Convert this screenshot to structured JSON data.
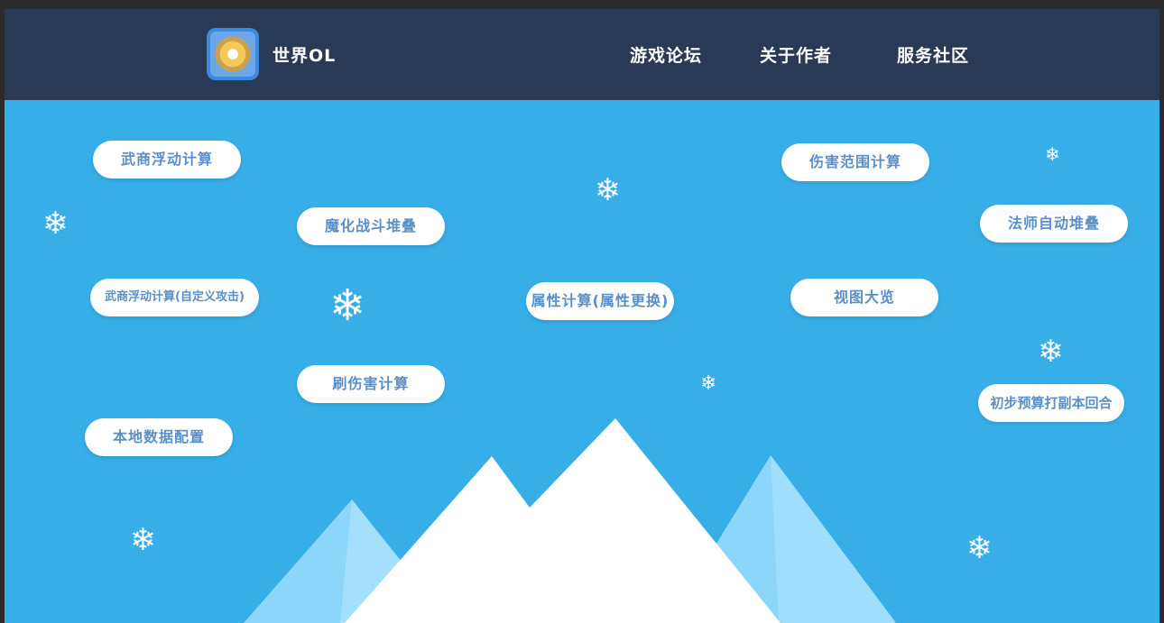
{
  "header": {
    "logo_icon": "dragon-emblem-icon",
    "brand": "世界OL",
    "nav": [
      "游戏论坛",
      "关于作者",
      "服务社区"
    ]
  },
  "menu": {
    "wushang_float": "武商浮动计算",
    "wushang_float_custom": "武商浮动计算(自定义攻击)",
    "local_data": "本地数据配置",
    "enchant_stack": "魔化战斗堆叠",
    "refresh_damage": "刷伤害计算",
    "attr_calc": "属性计算(属性更换)",
    "damage_range": "伤害范围计算",
    "view_overview": "视图大览",
    "mage_auto_stack": "法师自动堆叠",
    "dungeon_rounds": "初步预算打副本回合"
  },
  "decor": {
    "snowflake_glyph": "❄",
    "snowflake_icon": "snowflake-icon",
    "mountain_icon": "snow-mountain-icon"
  },
  "colors": {
    "header_bg": "#283a55",
    "scene_bg": "#37aee8",
    "pill_text": "#5a8fc8",
    "mountain_light": "#8dd6fb",
    "mountain_white": "#ffffff"
  }
}
